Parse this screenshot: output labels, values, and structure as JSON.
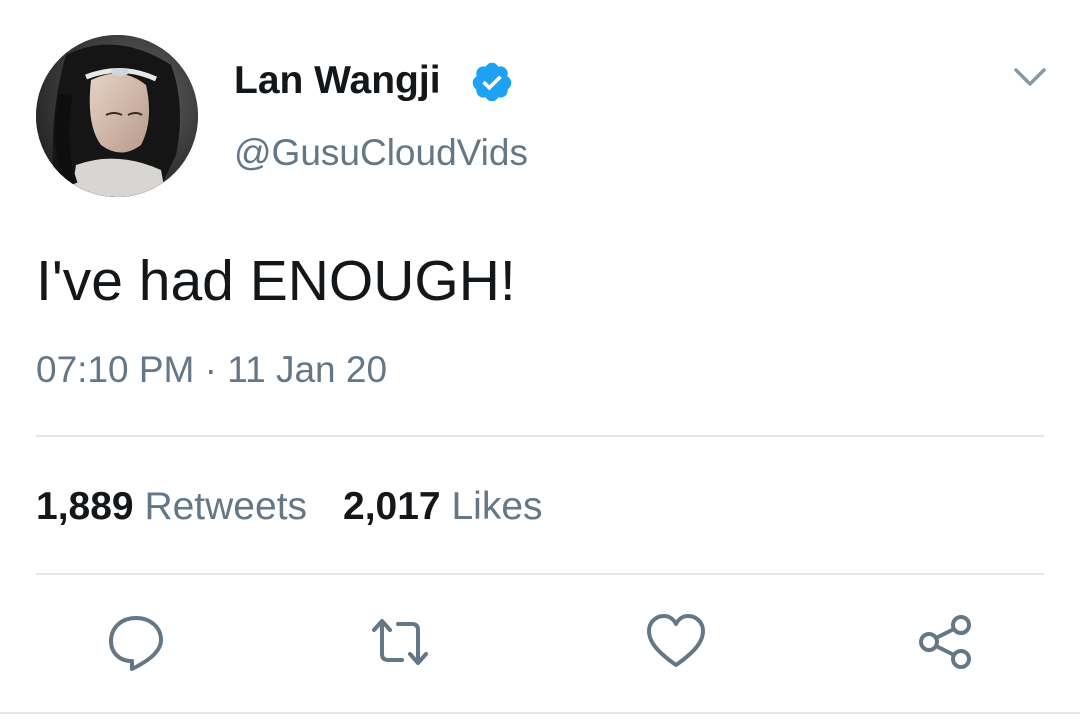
{
  "tweet": {
    "display_name": "Lan Wangji",
    "handle": "@GusuCloudVids",
    "verified": true,
    "text": "I've had ENOUGH!",
    "time": "07:10 PM",
    "separator": "·",
    "date": "11 Jan 20",
    "retweets_count": "1,889",
    "retweets_label": "Retweets",
    "likes_count": "2,017",
    "likes_label": "Likes"
  },
  "icons": {
    "avatar": "profile-photo",
    "verified": "verified-badge-icon",
    "menu": "chevron-down-icon",
    "reply": "reply-icon",
    "retweet": "retweet-icon",
    "like": "heart-icon",
    "share": "share-icon"
  },
  "colors": {
    "text_primary": "#14171a",
    "text_secondary": "#657786",
    "verified_blue": "#1da1f2",
    "divider": "#e1e8ed"
  }
}
